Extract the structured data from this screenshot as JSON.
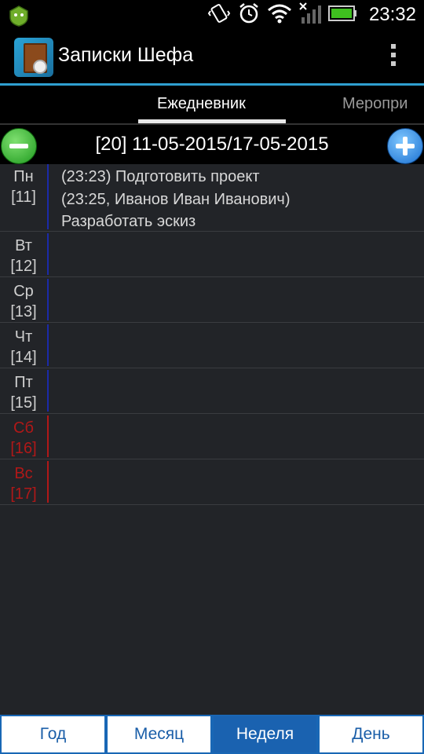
{
  "status_bar": {
    "time": "23:32",
    "icons": [
      "android-shield-icon",
      "vibrate-icon",
      "alarm-icon",
      "wifi-icon",
      "signal-icon",
      "battery-icon"
    ],
    "battery_color": "#3fbf1f"
  },
  "app": {
    "title": "Записки Шефа"
  },
  "tabs": [
    {
      "label": "Ежедневник",
      "active": true
    },
    {
      "label": "Меропри",
      "active": false
    }
  ],
  "week": {
    "title": "[20] 11-05-2015/17-05-2015"
  },
  "days": [
    {
      "name": "Пн",
      "num": "[11]",
      "weekend": false,
      "events": [
        {
          "line1": "(23:23) Подготовить проект"
        },
        {
          "line1": "(23:25, Иванов Иван Иванович)",
          "line2": "Разработать эскиз"
        }
      ]
    },
    {
      "name": "Вт",
      "num": "[12]",
      "weekend": false,
      "events": []
    },
    {
      "name": "Ср",
      "num": "[13]",
      "weekend": false,
      "events": []
    },
    {
      "name": "Чт",
      "num": "[14]",
      "weekend": false,
      "events": []
    },
    {
      "name": "Пт",
      "num": "[15]",
      "weekend": false,
      "events": []
    },
    {
      "name": "Сб",
      "num": "[16]",
      "weekend": true,
      "events": []
    },
    {
      "name": "Вс",
      "num": "[17]",
      "weekend": true,
      "events": []
    }
  ],
  "bottom_nav": [
    {
      "label": "Год",
      "active": false
    },
    {
      "label": "Месяц",
      "active": false
    },
    {
      "label": "Неделя",
      "active": true
    },
    {
      "label": "День",
      "active": false
    }
  ],
  "colors": {
    "accent_line": "#2f9fd0",
    "weekday_bar": "#1b2aa8",
    "weekend": "#b01818",
    "nav_active": "#1a62b0"
  }
}
